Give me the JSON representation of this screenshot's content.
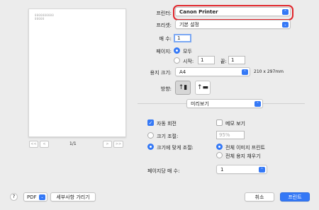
{
  "preview": {
    "text_line1": "0000000000",
    "text_line2": "00000",
    "page_indicator": "1/1",
    "first": "<<",
    "prev": "<",
    "next": ">",
    "last": ">>"
  },
  "printer": {
    "label": "프린터:",
    "value": "Canon Printer"
  },
  "preset": {
    "label": "프리셋:",
    "value": "기본 설정"
  },
  "copies": {
    "label": "매 수:",
    "value": "1"
  },
  "pages": {
    "label": "페이지:",
    "all_label": "모두",
    "from_label": "시작:",
    "from_value": "1",
    "to_label": "끝:",
    "to_value": "1"
  },
  "paper_size": {
    "label": "용지 크기:",
    "value": "A4",
    "dimensions": "210 x 297mm"
  },
  "orientation": {
    "label": "방향:"
  },
  "section": {
    "value": "미리보기"
  },
  "options": {
    "auto_rotate": "자동 회전",
    "show_notes": "메모 보기",
    "scale_label": "크기 조절:",
    "scale_value": "95%",
    "fit_label": "크기에 맞게 조절:",
    "fit_print_entire": "전체 이미지 프린트",
    "fit_fill_paper": "전체 용지 채우기",
    "per_page_label": "페이지당 매 수:",
    "per_page_value": "1"
  },
  "footer": {
    "help": "?",
    "pdf": "PDF",
    "hide_details": "세부사항 가리기",
    "cancel": "취소",
    "print": "프린트"
  },
  "colors": {
    "accent": "#3478f6",
    "highlight_ring": "#e0252b"
  }
}
